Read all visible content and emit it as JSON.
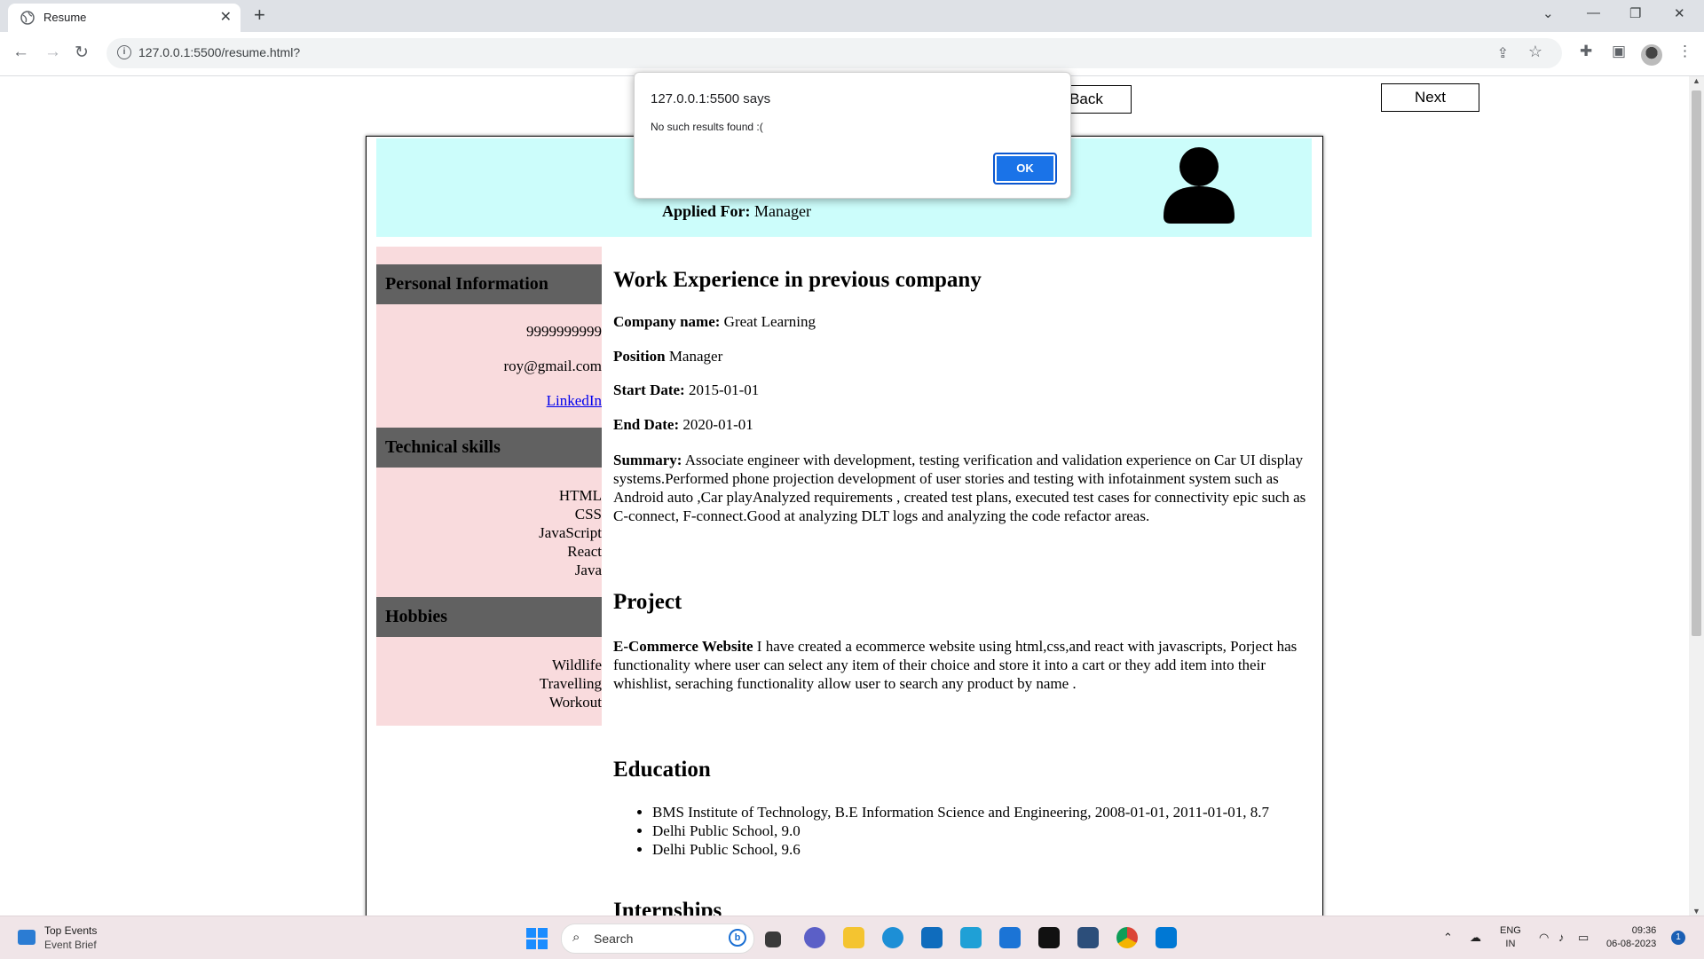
{
  "browser": {
    "tab_title": "Resume",
    "url": "127.0.0.1:5500/resume.html?"
  },
  "page": {
    "back_button": "Back",
    "next_button": "Next"
  },
  "resume": {
    "applied_for_label": "Applied For:",
    "applied_for_value": " Manager",
    "sidebar": {
      "personal_heading": "Personal Information",
      "phone": "9999999999",
      "email": "roy@gmail.com",
      "linkedin": "LinkedIn",
      "skills_heading": "Technical skills",
      "skills": [
        "HTML",
        "CSS",
        "JavaScript",
        "React",
        "Java"
      ],
      "hobbies_heading": "Hobbies",
      "hobbies": [
        "Wildlife",
        "Travelling",
        "Workout"
      ]
    },
    "work": {
      "heading": "Work Experience in previous company",
      "company_label": "Company name:",
      "company_value": " Great Learning",
      "position_label": "Position",
      "position_value": " Manager",
      "start_label": "Start Date:",
      "start_value": " 2015-01-01",
      "end_label": "End Date:",
      "end_value": " 2020-01-01",
      "summary_label": "Summary:",
      "summary_value": " Associate engineer with development, testing verification and validation experience on Car UI display systems.Performed phone projection development of user stories and testing with infotainment system such as Android auto ,Car playAnalyzed requirements , created test plans, executed test cases for connectivity epic such as C-connect, F-connect.Good at analyzing DLT logs and analyzing the code refactor areas."
    },
    "project": {
      "heading": "Project",
      "name": "E-Commerce Website",
      "description": " I have created a ecommerce website using html,css,and react with javascripts, Porject has functionality where user can select any item of their choice and store it into a cart or they add item into their whishlist, seraching functionality allow user to search any product by name ."
    },
    "education": {
      "heading": "Education",
      "items": [
        "BMS Institute of Technology, B.E Information Science and Engineering, 2008-01-01, 2011-01-01, 8.7",
        "Delhi Public School, 9.0",
        "Delhi Public School, 9.6"
      ]
    },
    "next_heading_partial": "Internships"
  },
  "alert": {
    "origin": "127.0.0.1:5500 says",
    "message": "No such results found :(",
    "ok": "OK"
  },
  "taskbar": {
    "news_title": "Top Events",
    "news_subtitle": "Event Brief",
    "search_placeholder": "Search",
    "lang_top": "ENG",
    "lang_bottom": "IN",
    "time": "09:36",
    "date": "06-08-2023",
    "notification_count": "1"
  },
  "colors": {
    "header_bg": "#ccfdfb",
    "sidebar_bg": "#f9dbdd",
    "section_head_bg": "#616161",
    "alert_ok": "#1a73e8"
  }
}
